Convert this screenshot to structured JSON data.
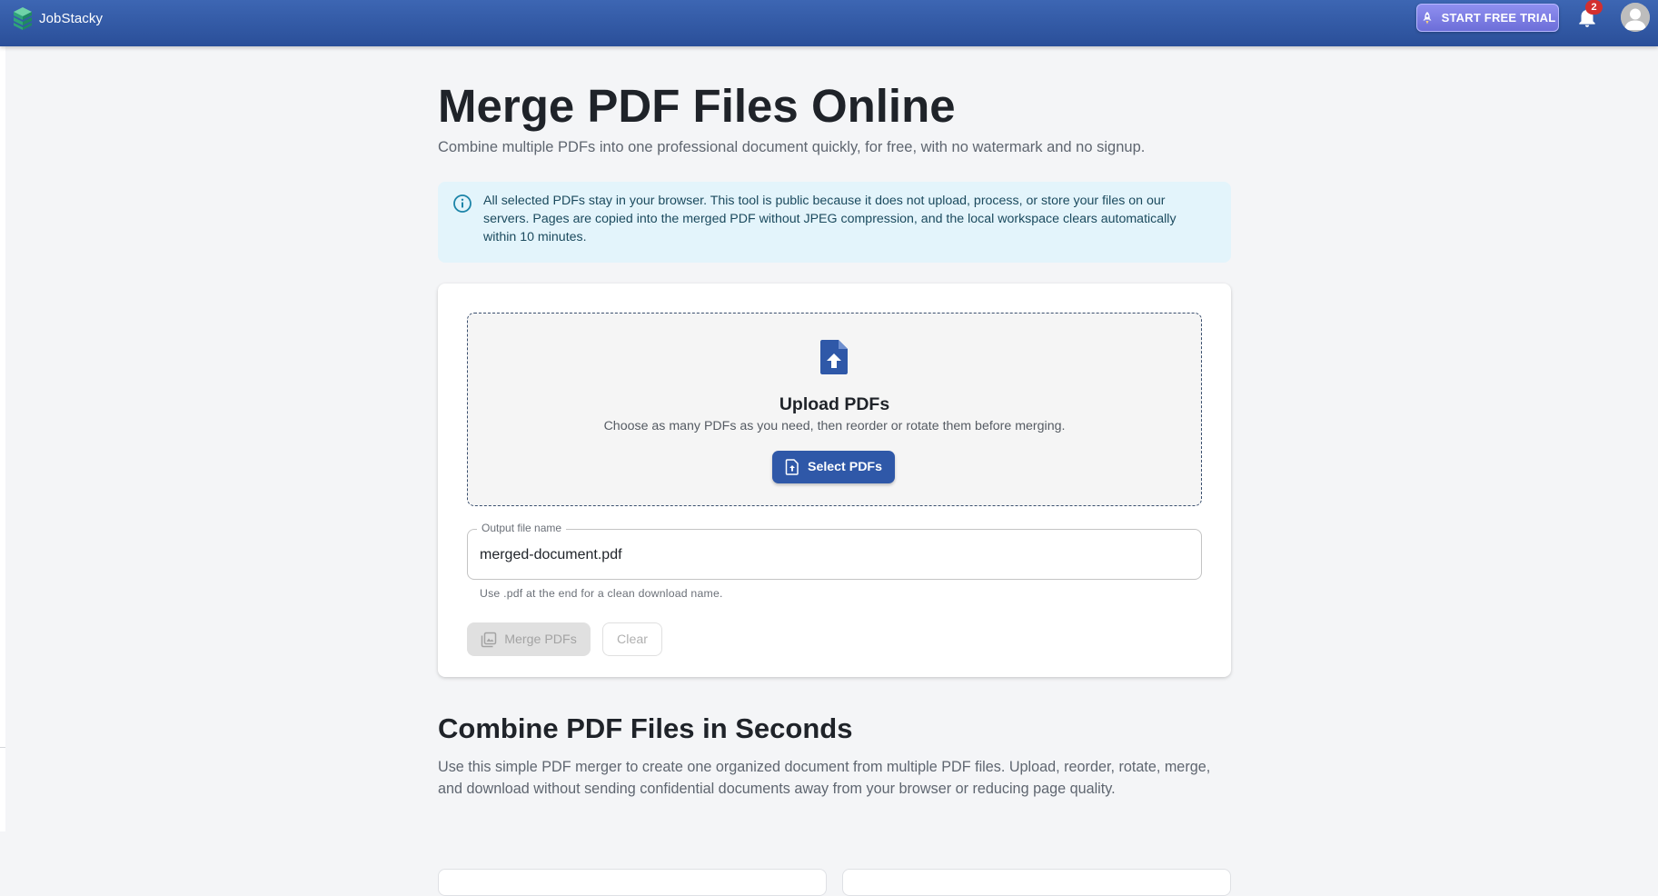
{
  "header": {
    "brand_name": "JobStacky",
    "trial_button_label": "START FREE TRIAL",
    "notification_count": "2",
    "accent_color": "#2f58a8"
  },
  "hero": {
    "title": "Merge PDF Files Online",
    "subtitle": "Combine multiple PDFs into one professional document quickly, for free, with no watermark and no signup."
  },
  "notice": {
    "text": "All selected PDFs stay in your browser. This tool is public because it does not upload, process, or store your files on our servers. Pages are copied into the merged PDF without JPEG compression, and the local workspace clears automatically within 10 minutes.",
    "icon": "info-icon"
  },
  "upload": {
    "title": "Upload PDFs",
    "description": "Choose as many PDFs as you need, then reorder or rotate them before merging.",
    "button_label": "Select PDFs"
  },
  "output": {
    "label": "Output file name",
    "value": "merged-document.pdf",
    "helper": "Use .pdf at the end for a clean download name."
  },
  "actions": {
    "merge_label": "Merge PDFs",
    "clear_label": "Clear"
  },
  "section": {
    "title": "Combine PDF Files in Seconds",
    "body": "Use this simple PDF merger to create one organized document from multiple PDF files. Upload, reorder, rotate, merge, and download without sending confidential documents away from your browser or reducing page quality."
  }
}
